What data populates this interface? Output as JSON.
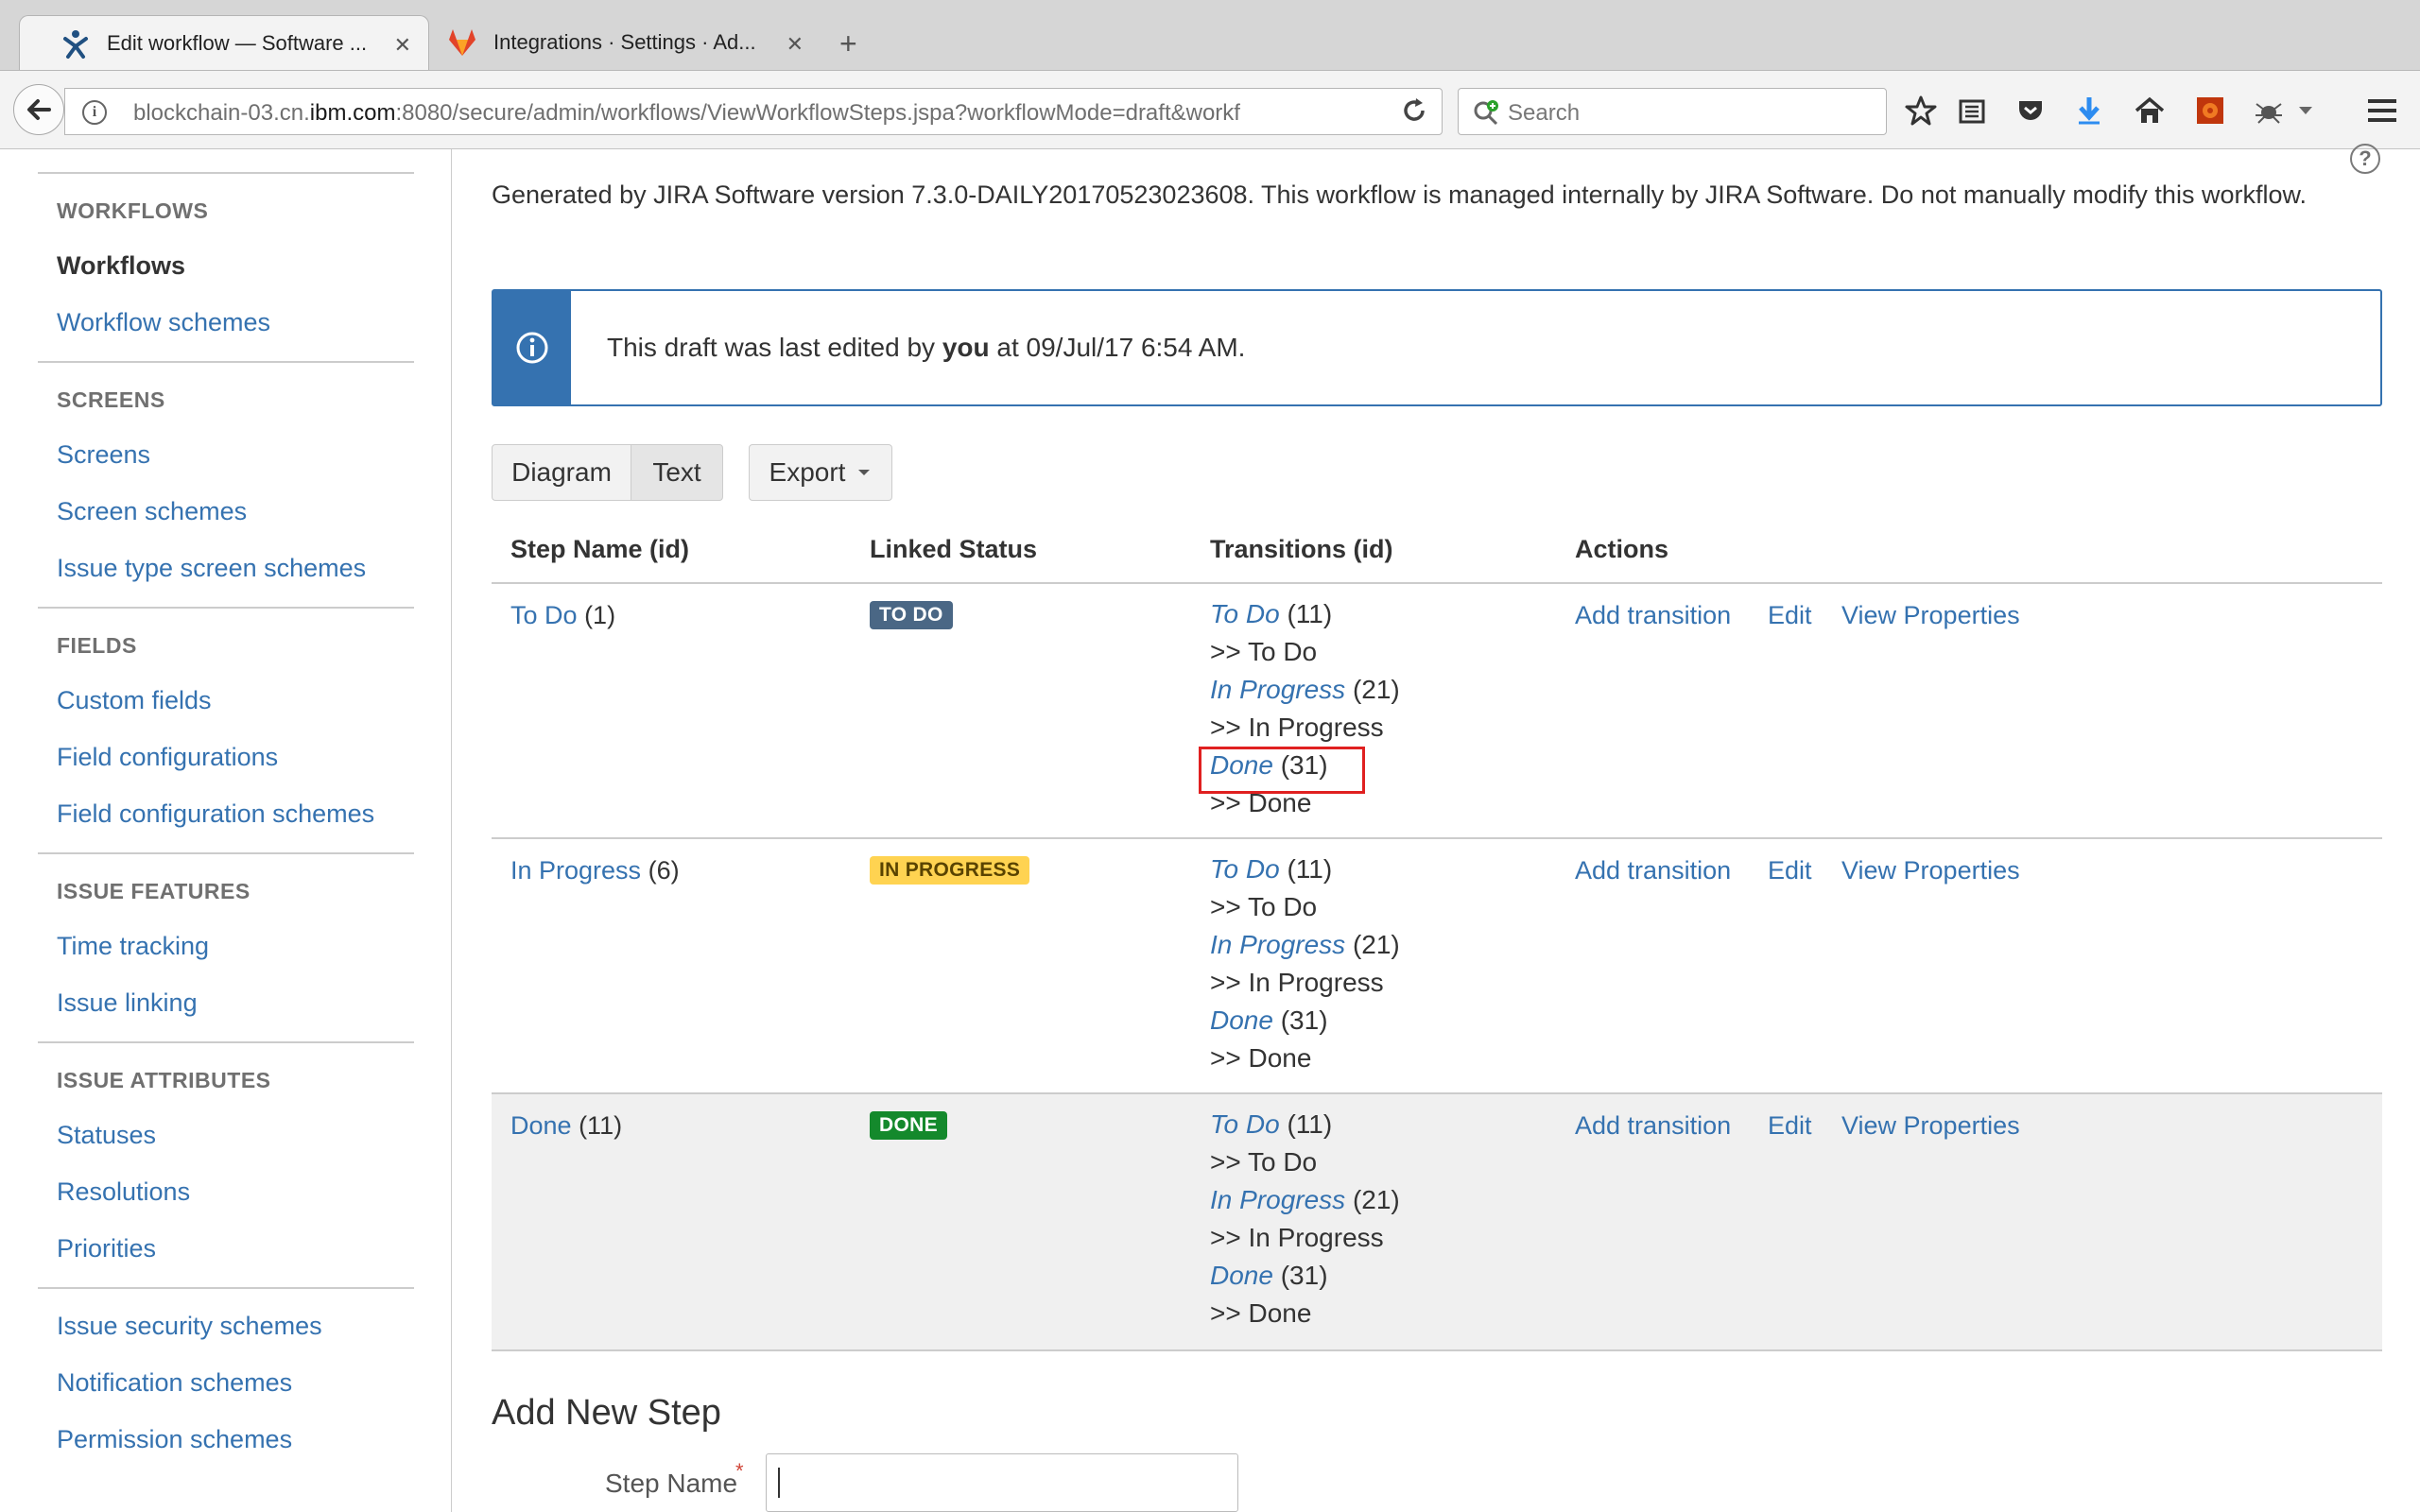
{
  "browser": {
    "tabs": [
      {
        "title": "Edit workflow — Software ...",
        "active": true,
        "icon": "jira-icon"
      },
      {
        "title": "Integrations · Settings · Ad...",
        "active": false,
        "icon": "gitlab-icon"
      }
    ],
    "new_tab": "+",
    "url_prefix": "blockchain-03.cn.",
    "url_domain": "ibm.com",
    "url_rest": ":8080/secure/admin/workflows/ViewWorkflowSteps.jspa?workflowMode=draft&workf",
    "search_placeholder": "Search"
  },
  "sidebar": {
    "sections": [
      {
        "heading": "WORKFLOWS",
        "items": [
          "Workflows",
          "Workflow schemes"
        ],
        "current": "Workflows"
      },
      {
        "heading": "SCREENS",
        "items": [
          "Screens",
          "Screen schemes",
          "Issue type screen schemes"
        ]
      },
      {
        "heading": "FIELDS",
        "items": [
          "Custom fields",
          "Field configurations",
          "Field configuration schemes"
        ]
      },
      {
        "heading": "ISSUE FEATURES",
        "items": [
          "Time tracking",
          "Issue linking"
        ]
      },
      {
        "heading": "ISSUE ATTRIBUTES",
        "items": [
          "Statuses",
          "Resolutions",
          "Priorities"
        ]
      },
      {
        "heading": "",
        "items": [
          "Issue security schemes",
          "Notification schemes",
          "Permission schemes"
        ]
      }
    ]
  },
  "main": {
    "generated_text": "Generated by JIRA Software version 7.3.0-DAILY20170523023608. This workflow is managed internally by JIRA Software. Do not manually modify this workflow.",
    "info": {
      "before": "This draft was last edited by ",
      "user": "you",
      "after": " at 09/Jul/17 6:54 AM."
    },
    "view_buttons": {
      "diagram": "Diagram",
      "text": "Text",
      "export": "Export"
    },
    "table": {
      "headers": [
        "Step Name (id)",
        "Linked Status",
        "Transitions (id)",
        "Actions"
      ],
      "rows": [
        {
          "step": "To Do",
          "id": "(1)",
          "status": "TO DO",
          "transitions": [
            {
              "name": "To Do",
              "id": "(11)",
              "target": ">> To Do"
            },
            {
              "name": "In Progress",
              "id": "(21)",
              "target": ">> In Progress"
            },
            {
              "name": "Done",
              "id": "(31)",
              "target": ">> Done"
            }
          ]
        },
        {
          "step": "In Progress",
          "id": "(6)",
          "status": "IN PROGRESS",
          "transitions": [
            {
              "name": "To Do",
              "id": "(11)",
              "target": ">> To Do"
            },
            {
              "name": "In Progress",
              "id": "(21)",
              "target": ">> In Progress"
            },
            {
              "name": "Done",
              "id": "(31)",
              "target": ">> Done"
            }
          ]
        },
        {
          "step": "Done",
          "id": "(11)",
          "status": "DONE",
          "transitions": [
            {
              "name": "To Do",
              "id": "(11)",
              "target": ">> To Do"
            },
            {
              "name": "In Progress",
              "id": "(21)",
              "target": ">> In Progress"
            },
            {
              "name": "Done",
              "id": "(31)",
              "target": ">> Done"
            }
          ]
        }
      ],
      "actions": {
        "add": "Add transition",
        "edit": "Edit",
        "view": "View Properties"
      }
    },
    "add_step": {
      "title": "Add New Step",
      "label": "Step Name",
      "required_mark": "*",
      "value": ""
    }
  },
  "colors": {
    "link": "#3572b0",
    "todo": "#4a6785",
    "inprogress": "#ffd351",
    "done": "#14892c",
    "highlight": "#e02020"
  }
}
